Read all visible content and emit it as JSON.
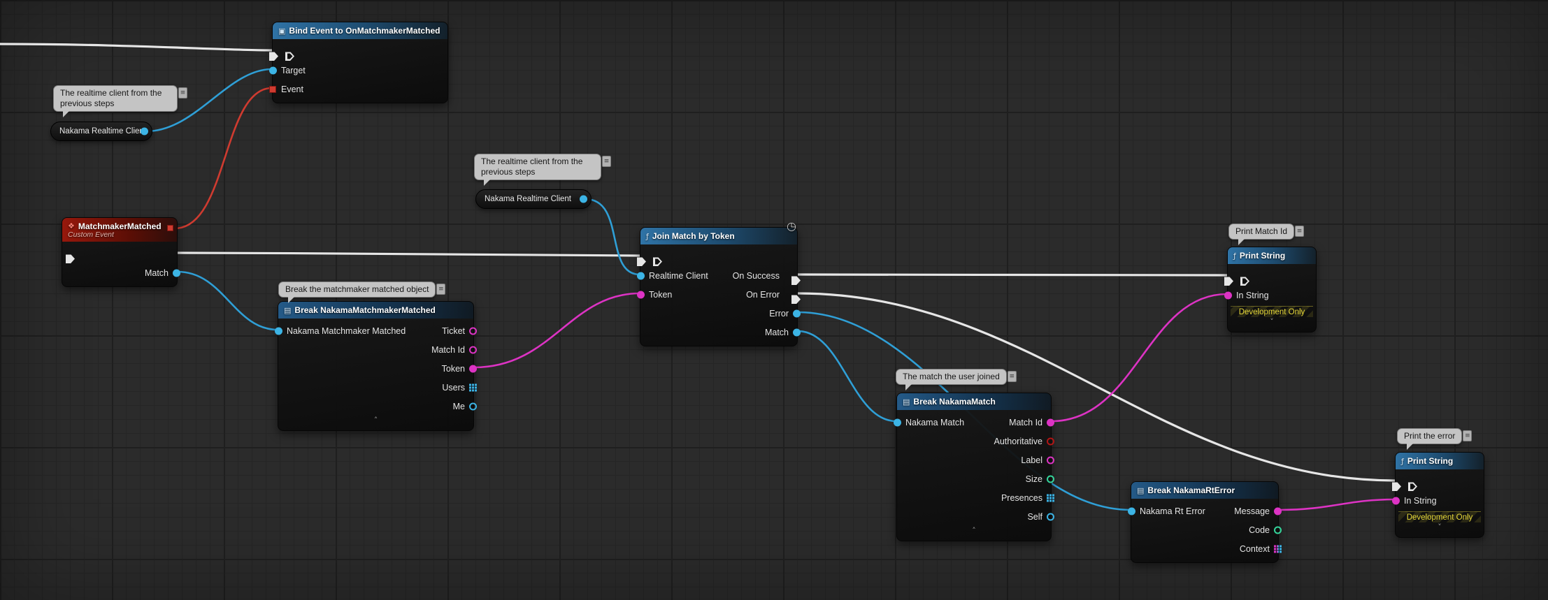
{
  "icons": {
    "function": "ƒ",
    "bind": "▣",
    "event": "❖",
    "break": "▤",
    "clock": "◷",
    "chevron_up": "˄",
    "chevron_down": "˅",
    "bubble_tab": "≡"
  },
  "colors": {
    "exec_wire": "#e6e6e6",
    "object_pin": "#3cb4e5",
    "string_pin": "#dd33c4",
    "delegate_pin": "#cf3b30",
    "bool_pin": "#b01515",
    "int_pin": "#35d59b",
    "dev_only_text": "#e6d839",
    "header_function": "#2f73a6",
    "header_break": "#245a88",
    "header_event": "#97180c"
  },
  "bubbles": {
    "realtime_top": "The realtime client from the previous steps",
    "realtime_mid": "The realtime client from the previous steps",
    "break_matchmaker": "Break the matchmaker matched object",
    "print_match_id": "Print Match Id",
    "match_joined": "The match the user joined",
    "print_error": "Print the error"
  },
  "nodes": {
    "bind_event": {
      "title": "Bind Event to OnMatchmakerMatched",
      "target_label": "Target",
      "event_label": "Event"
    },
    "realtime_client_1": {
      "label": "Nakama Realtime Client"
    },
    "realtime_client_2": {
      "label": "Nakama Realtime Client"
    },
    "matchmaker_matched": {
      "title": "MatchmakerMatched",
      "subtitle": "Custom Event",
      "match_label": "Match"
    },
    "join_match": {
      "title": "Join Match by Token",
      "realtime_client_label": "Realtime Client",
      "token_label": "Token",
      "on_success_label": "On Success",
      "on_error_label": "On Error",
      "error_label": "Error",
      "match_label": "Match"
    },
    "break_matchmaker": {
      "title": "Break NakamaMatchmakerMatched",
      "input_label": "Nakama Matchmaker Matched",
      "outputs": [
        "Ticket",
        "Match Id",
        "Token",
        "Users",
        "Me"
      ]
    },
    "print_string_1": {
      "title": "Print String",
      "in_string_label": "In String",
      "dev_only": "Development Only"
    },
    "break_match": {
      "title": "Break NakamaMatch",
      "input_label": "Nakama Match",
      "outputs": [
        "Match Id",
        "Authoritative",
        "Label",
        "Size",
        "Presences",
        "Self"
      ]
    },
    "break_rterror": {
      "title": "Break NakamaRtError",
      "input_label": "Nakama Rt Error",
      "outputs": [
        "Message",
        "Code",
        "Context"
      ]
    },
    "print_string_2": {
      "title": "Print String",
      "in_string_label": "In String",
      "dev_only": "Development Only"
    }
  }
}
